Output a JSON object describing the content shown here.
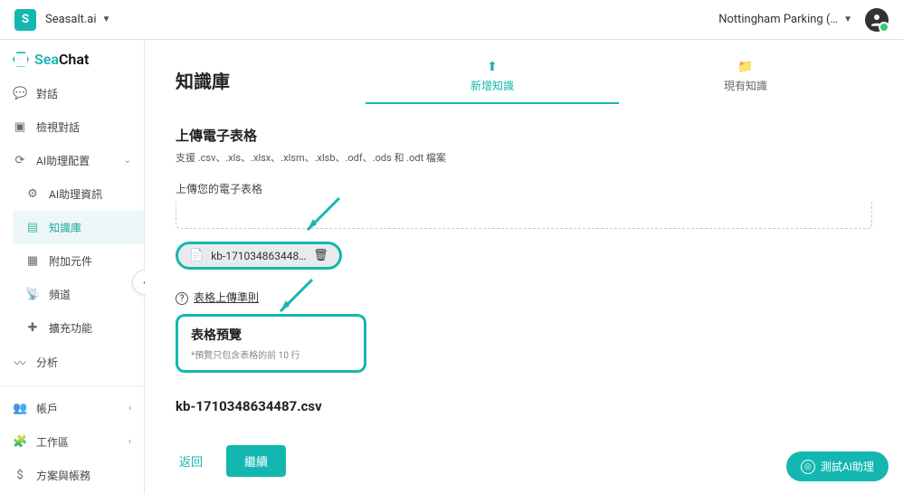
{
  "header": {
    "brand_letter": "S",
    "brand_name": "Seasalt.ai",
    "account_name": "Nottingham Parking (…"
  },
  "logo": {
    "part1": "Sea",
    "part2": "Chat"
  },
  "sidebar": {
    "items": [
      {
        "icon": "💬",
        "label": "對話"
      },
      {
        "icon": "▣",
        "label": "檢視對話"
      },
      {
        "icon": "⟳",
        "label": "AI助理配置",
        "expandable": true
      },
      {
        "icon": "⚙",
        "label": "AI助理資訊",
        "sub": true
      },
      {
        "icon": "▤",
        "label": "知識庫",
        "sub": true,
        "active": true
      },
      {
        "icon": "▦",
        "label": "附加元件",
        "sub": true
      },
      {
        "icon": "📡",
        "label": "頻道",
        "sub": true
      },
      {
        "icon": "✚",
        "label": "擴充功能",
        "sub": true
      },
      {
        "icon": "〰",
        "label": "分析"
      },
      {
        "icon": "👥",
        "label": "帳戶",
        "chevron": true
      },
      {
        "icon": "🧩",
        "label": "工作區",
        "chevron": true
      },
      {
        "icon": "$",
        "label": "方案與帳務"
      }
    ]
  },
  "page": {
    "title": "知識庫",
    "tabs": [
      {
        "icon": "⬆",
        "label": "新增知識",
        "active": true
      },
      {
        "icon": "📁",
        "label": "現有知識"
      }
    ],
    "upload": {
      "section_title": "上傳電子表格",
      "support_line": "支援 .csv、.xls、.xlsx、.xlsm、.xlsb、.odf、.ods 和 .odt 檔案",
      "upload_label": "上傳您的電子表格",
      "file_chip": "kb-171034863448…",
      "guideline_label": "表格上傳準則",
      "preview_title": "表格預覽",
      "preview_sub": "*預覽只包含表格的前 10 行",
      "file_name": "kb-1710348634487.csv"
    },
    "actions": {
      "back": "返回",
      "continue": "繼續"
    },
    "fab": "測試AI助理"
  }
}
